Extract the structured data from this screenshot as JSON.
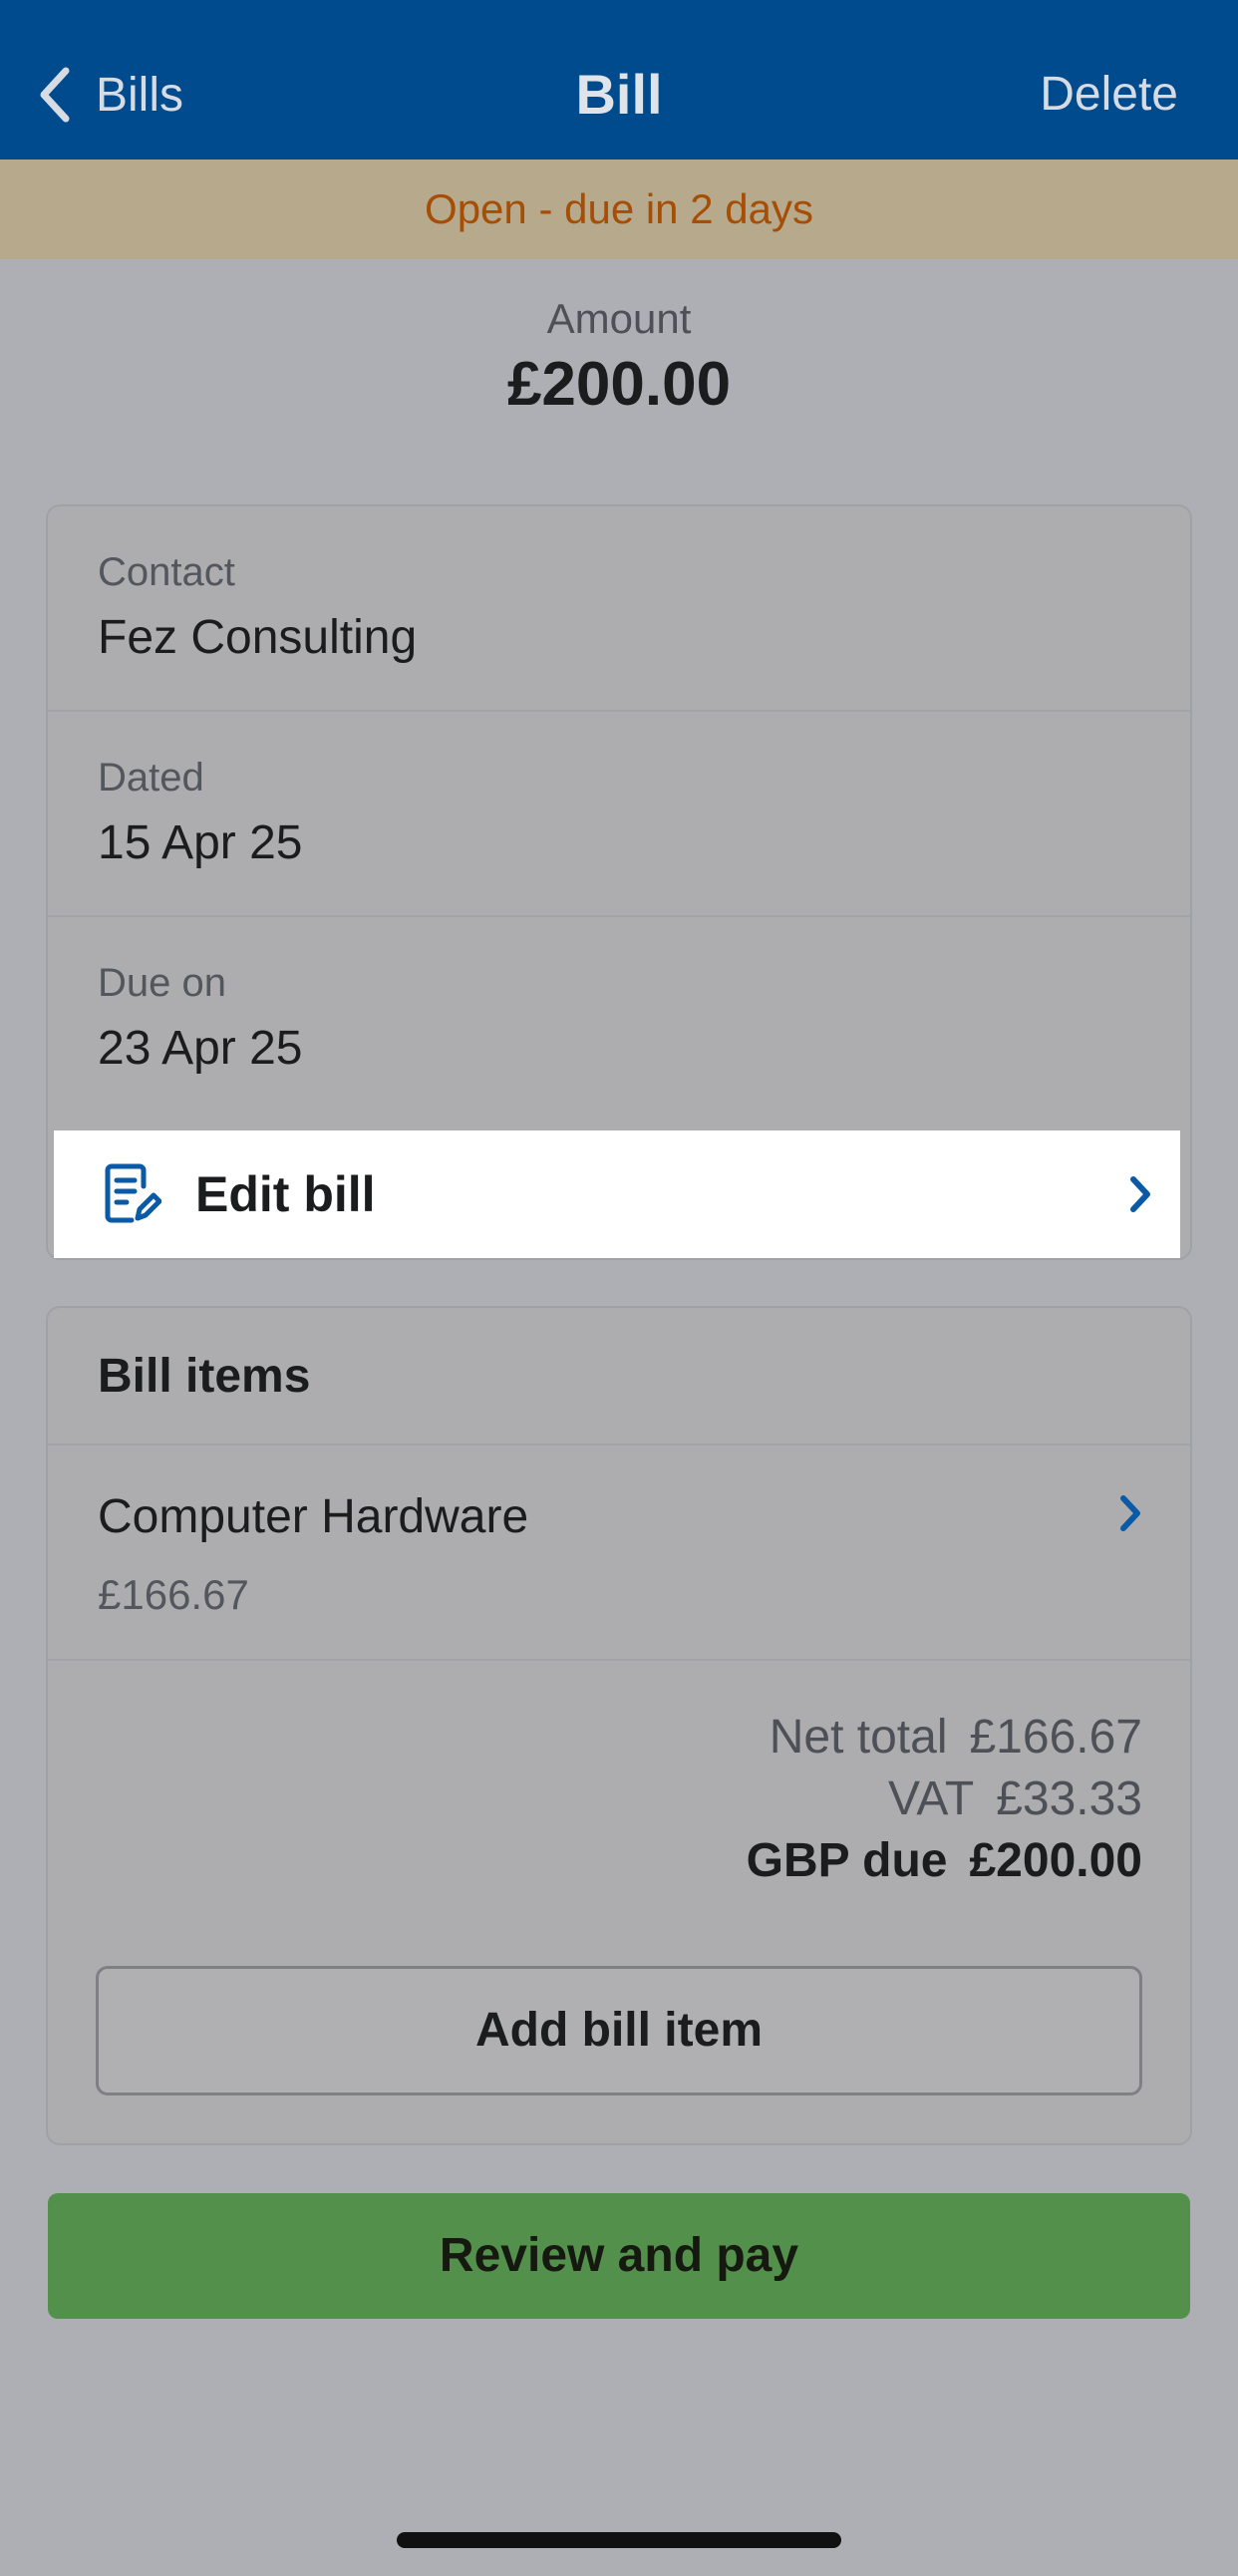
{
  "nav": {
    "back_label": "Bills",
    "title": "Bill",
    "delete_label": "Delete"
  },
  "status": {
    "text": "Open - due in 2 days"
  },
  "amount": {
    "label": "Amount",
    "value": "£200.00"
  },
  "details": {
    "contact": {
      "label": "Contact",
      "value": "Fez Consulting"
    },
    "dated": {
      "label": "Dated",
      "value": "15 Apr 25"
    },
    "due_on": {
      "label": "Due on",
      "value": "23 Apr 25"
    },
    "edit_label": "Edit bill"
  },
  "bill_items": {
    "header": "Bill items",
    "items": [
      {
        "name": "Computer Hardware",
        "price": "£166.67"
      }
    ],
    "totals": {
      "net_label": "Net total",
      "net_value": "£166.67",
      "vat_label": "VAT",
      "vat_value": "£33.33",
      "due_label": "GBP due",
      "due_value": "£200.00"
    },
    "add_label": "Add bill item"
  },
  "actions": {
    "pay_label": "Review and pay"
  },
  "colors": {
    "nav_bg": "#004b8d",
    "status_bg": "#b7a98b",
    "status_text": "#a64d06",
    "pay_button": "#53904c",
    "accent_chevron": "#0a5aa6"
  },
  "icons": {
    "back": "chevron-left-icon",
    "edit": "edit-document-icon",
    "row_chevron": "chevron-right-icon"
  }
}
